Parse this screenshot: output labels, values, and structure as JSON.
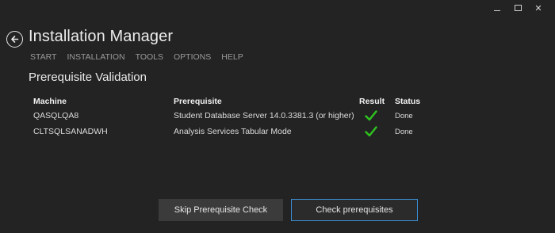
{
  "window": {
    "minimize_label": "—",
    "maximize_label": "□",
    "close_label": "✕"
  },
  "app": {
    "title": "Installation Manager"
  },
  "menu": [
    "START",
    "INSTALLATION",
    "TOOLS",
    "OPTIONS",
    "HELP"
  ],
  "section": {
    "title": "Prerequisite Validation"
  },
  "table": {
    "headers": {
      "machine": "Machine",
      "prerequisite": "Prerequisite",
      "result": "Result",
      "status": "Status"
    },
    "rows": [
      {
        "machine": "QASQLQA8",
        "prerequisite": "Student Database Server 14.0.3381.3 (or higher)",
        "result": "check-icon",
        "status": "Done"
      },
      {
        "machine": "CLTSQLSANADWH",
        "prerequisite": "Analysis Services Tabular Mode",
        "result": "check-icon",
        "status": "Done"
      }
    ]
  },
  "buttons": {
    "skip": "Skip Prerequisite Check",
    "check": "Check prerequisites"
  },
  "colors": {
    "background": "#232323",
    "accent_border": "#3b8fd6",
    "success": "#2ec31f"
  }
}
